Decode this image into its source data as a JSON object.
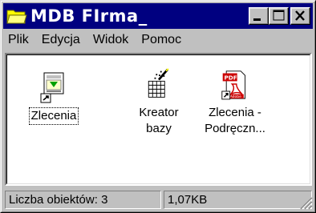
{
  "window": {
    "title": "MDB FIrma_",
    "menu": [
      "Plik",
      "Edycja",
      "Widok",
      "Pomoc"
    ]
  },
  "files": [
    {
      "label": "Zlecenia",
      "icon": "install-package-shortcut-icon",
      "selected": true
    },
    {
      "label": "Kreator\nbazy",
      "icon": "database-wizard-icon",
      "selected": false
    },
    {
      "label": "Zlecenia -\nPodręczn...",
      "icon": "pdf-document-shortcut-icon",
      "selected": false
    }
  ],
  "status": {
    "count": "Liczba obiektów: 3",
    "size": "1,07KB"
  },
  "colors": {
    "titlebar": "#000080",
    "face": "#c0c0c0",
    "pdf": "#cc0000"
  }
}
